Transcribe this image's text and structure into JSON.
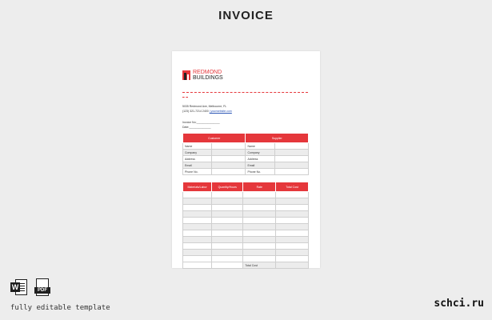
{
  "page": {
    "title": "INVOICE"
  },
  "document": {
    "brand_line1": "REDMOND",
    "brand_line2": "BUILDINGS",
    "address": "5035 Redmond Ave, Melbourne, FL",
    "phone": "(123) 321-7214 2400",
    "email": "| yourwebsite.com",
    "invoice_no": "Invoice No:_______________",
    "date": "Date:______________",
    "parties_table": {
      "headers": [
        "Customer",
        "Supplier"
      ],
      "rows": [
        [
          "Name",
          "Name"
        ],
        [
          "Company",
          "Company"
        ],
        [
          "Address",
          "Address"
        ],
        [
          "Email",
          "Email"
        ],
        [
          "Phone No.",
          "Phone No."
        ]
      ]
    },
    "items_table": {
      "headers": [
        "Materials/Labor",
        "Quantity/Hours",
        "Rate",
        "Total Cost"
      ],
      "row_count": 11,
      "total_label": "Total Cost"
    }
  },
  "footer": {
    "word_badge": "W",
    "pdf_badge": "PDF",
    "caption": "fully editable template",
    "site": "schci.ru"
  },
  "colors": {
    "accent": "#e5373b",
    "background": "#ededed"
  }
}
